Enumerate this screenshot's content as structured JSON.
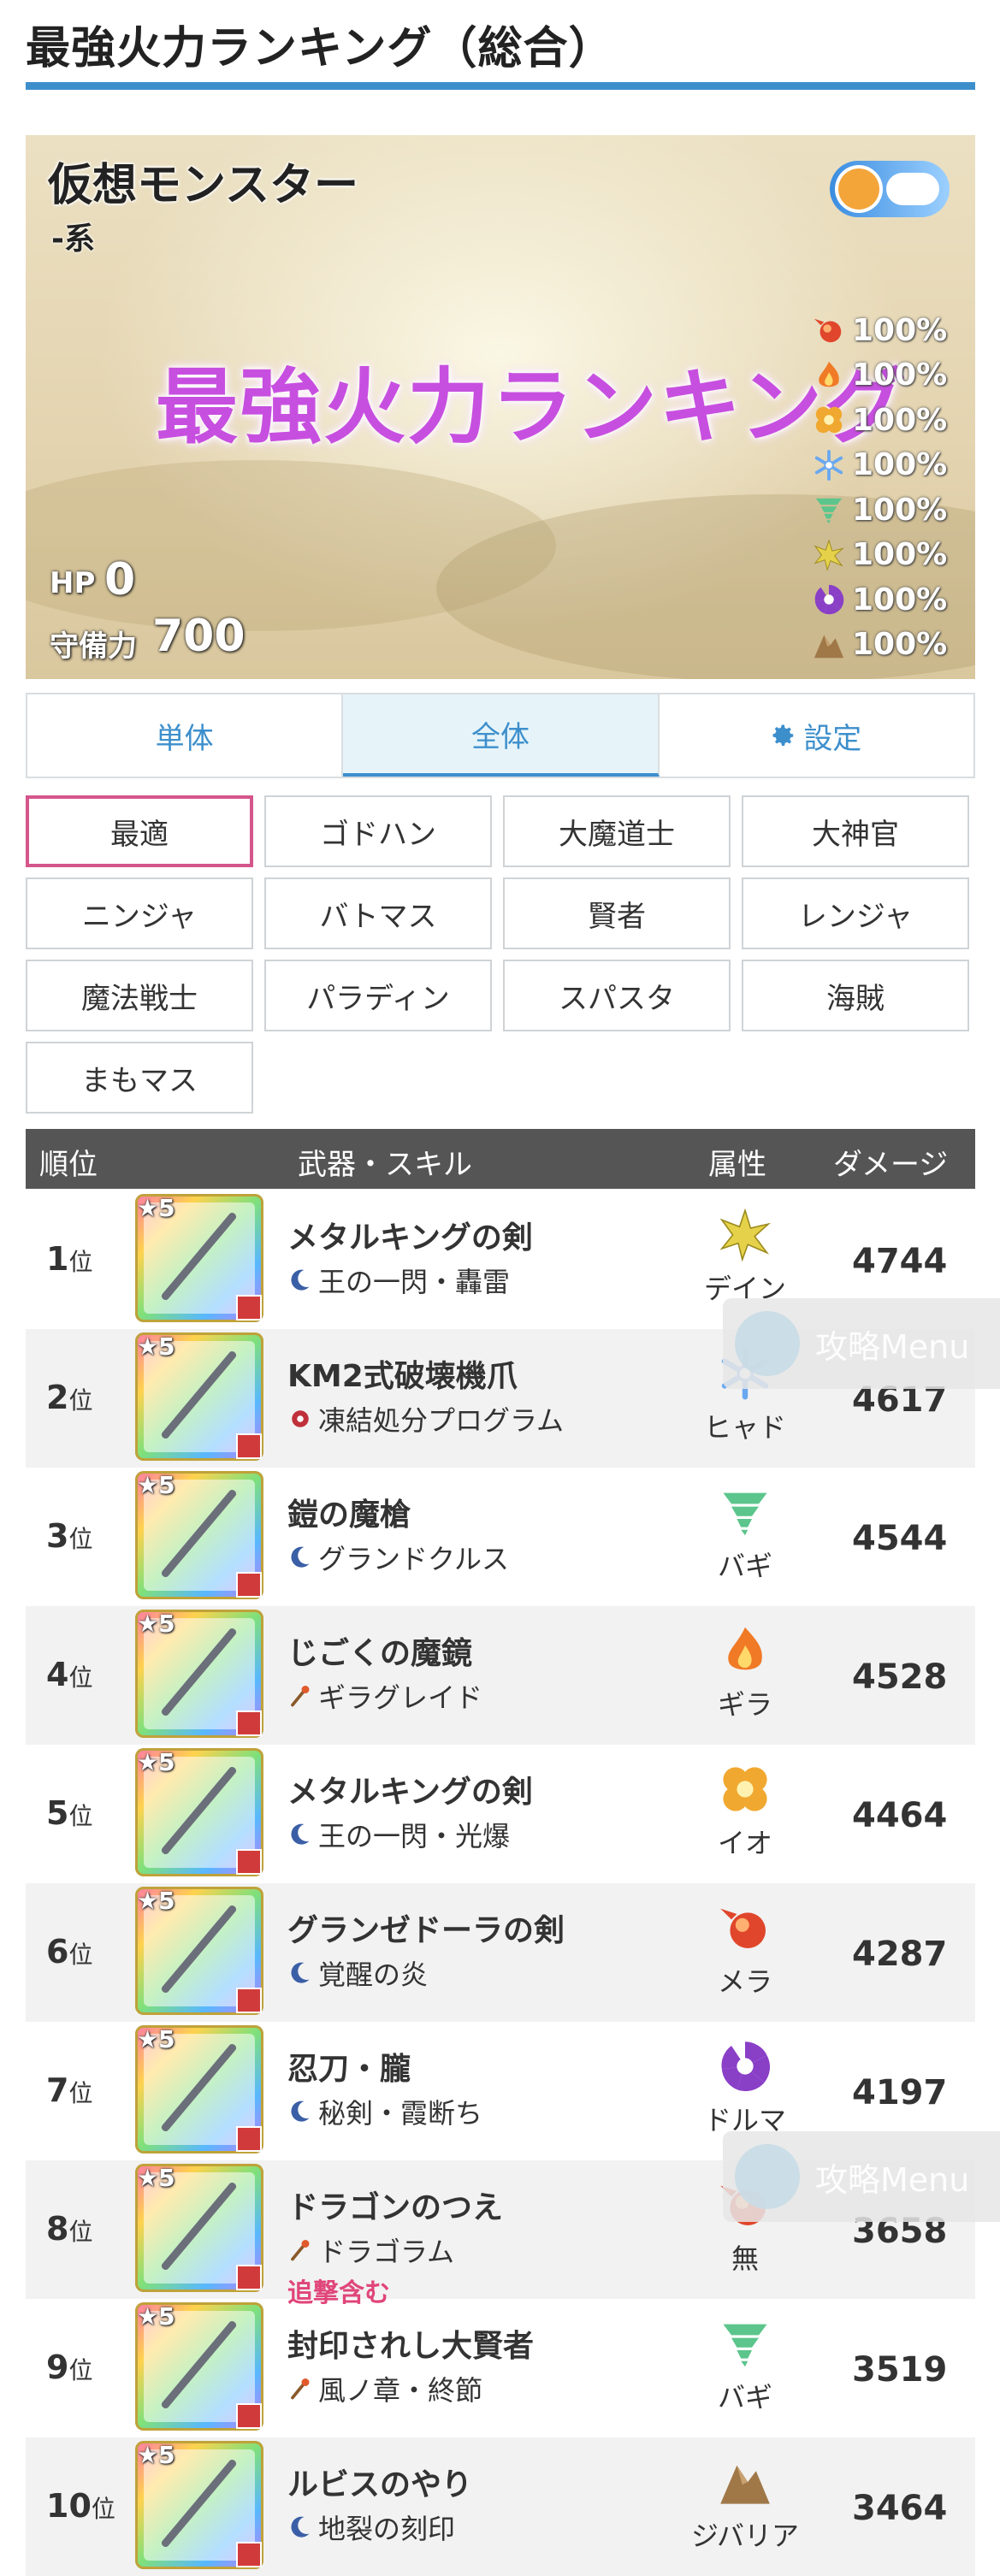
{
  "page": {
    "title": "最強火力ランキング（総合）"
  },
  "monster": {
    "name": "仮想モンスター",
    "type": "-系",
    "overlay_label": "最強火力ランキング",
    "hp_label": "HP",
    "hp_value": "0",
    "def_label": "守備力",
    "def_value": "700",
    "weather_icon": "sun-cloud-icon",
    "resistances": [
      {
        "element": "メラ",
        "icon": "fire-ball-icon",
        "color": "#e0462b",
        "value": "100%"
      },
      {
        "element": "ギラ",
        "icon": "flame-icon",
        "color": "#f07a26",
        "value": "100%"
      },
      {
        "element": "イオ",
        "icon": "explosion-icon",
        "color": "#f0a830",
        "value": "100%"
      },
      {
        "element": "ヒャド",
        "icon": "snowflake-icon",
        "color": "#6aa8f0",
        "value": "100%"
      },
      {
        "element": "バギ",
        "icon": "tornado-icon",
        "color": "#5cc58c",
        "value": "100%"
      },
      {
        "element": "デイン",
        "icon": "lightning-icon",
        "color": "#e6d24a",
        "value": "100%"
      },
      {
        "element": "ドルマ",
        "icon": "dark-swirl-icon",
        "color": "#8a3fc7",
        "value": "100%"
      },
      {
        "element": "ジバリア",
        "icon": "rock-icon",
        "color": "#a07848",
        "value": "100%"
      }
    ]
  },
  "tabs": [
    {
      "label": "単体"
    },
    {
      "label": "全体"
    },
    {
      "label": "設定"
    }
  ],
  "jobs": [
    "最適",
    "ゴドハン",
    "大魔道士",
    "大神官",
    "ニンジャ",
    "バトマス",
    "賢者",
    "レンジャ",
    "魔法戦士",
    "パラディン",
    "スパスタ",
    "海賊",
    "まもマス"
  ],
  "table": {
    "headers": {
      "rank": "順位",
      "weapon": "武器・スキル",
      "element": "属性",
      "damage": "ダメージ"
    },
    "rank_suffix": "位",
    "rows": [
      {
        "rank": "1",
        "weapon": "メタルキングの剣",
        "skill": "王の一閃・轟雷",
        "skill_icon": "crescent-icon",
        "element": "デイン",
        "element_icon": "lightning-icon",
        "element_color": "#e6d24a",
        "damage": "4744",
        "extra": ""
      },
      {
        "rank": "2",
        "weapon": "KM2式破壊機爪",
        "skill": "凍結処分プログラム",
        "skill_icon": "gear-icon",
        "element": "ヒャド",
        "element_icon": "snowflake-icon",
        "element_color": "#6aa8f0",
        "damage": "4617",
        "extra": ""
      },
      {
        "rank": "3",
        "weapon": "鎧の魔槍",
        "skill": "グランドクルス",
        "skill_icon": "crescent-icon",
        "element": "バギ",
        "element_icon": "tornado-icon",
        "element_color": "#5cc58c",
        "damage": "4544",
        "extra": ""
      },
      {
        "rank": "4",
        "weapon": "じごくの魔鏡",
        "skill": "ギラグレイド",
        "skill_icon": "wand-icon",
        "element": "ギラ",
        "element_icon": "flame-icon",
        "element_color": "#f07a26",
        "damage": "4528",
        "extra": ""
      },
      {
        "rank": "5",
        "weapon": "メタルキングの剣",
        "skill": "王の一閃・光爆",
        "skill_icon": "crescent-icon",
        "element": "イオ",
        "element_icon": "explosion-icon",
        "element_color": "#f0a830",
        "damage": "4464",
        "extra": ""
      },
      {
        "rank": "6",
        "weapon": "グランゼドーラの剣",
        "skill": "覚醒の炎",
        "skill_icon": "crescent-icon",
        "element": "メラ",
        "element_icon": "fire-ball-icon",
        "element_color": "#e0462b",
        "damage": "4287",
        "extra": ""
      },
      {
        "rank": "7",
        "weapon": "忍刀・朧",
        "skill": "秘剣・霞断ち",
        "skill_icon": "crescent-icon",
        "element": "ドルマ",
        "element_icon": "dark-swirl-icon",
        "element_color": "#8a3fc7",
        "damage": "4197",
        "extra": ""
      },
      {
        "rank": "8",
        "weapon": "ドラゴンのつえ",
        "skill": "ドラゴラム",
        "skill_icon": "wand-icon",
        "element": "無",
        "element_icon": "fire-ball-icon",
        "element_color": "#e0462b",
        "damage": "3658",
        "extra": "追撃含む"
      },
      {
        "rank": "9",
        "weapon": "封印されし大賢者",
        "skill": "風ノ章・終節",
        "skill_icon": "wand-icon",
        "element": "バギ",
        "element_icon": "tornado-icon",
        "element_color": "#5cc58c",
        "damage": "3519",
        "extra": ""
      },
      {
        "rank": "10",
        "weapon": "ルビスのやり",
        "skill": "地裂の刻印",
        "skill_icon": "crescent-icon",
        "element": "ジバリア",
        "element_icon": "rock-icon",
        "element_color": "#a07848",
        "damage": "3464",
        "extra": ""
      }
    ]
  },
  "floating_menu": {
    "label": "攻略Menu"
  }
}
